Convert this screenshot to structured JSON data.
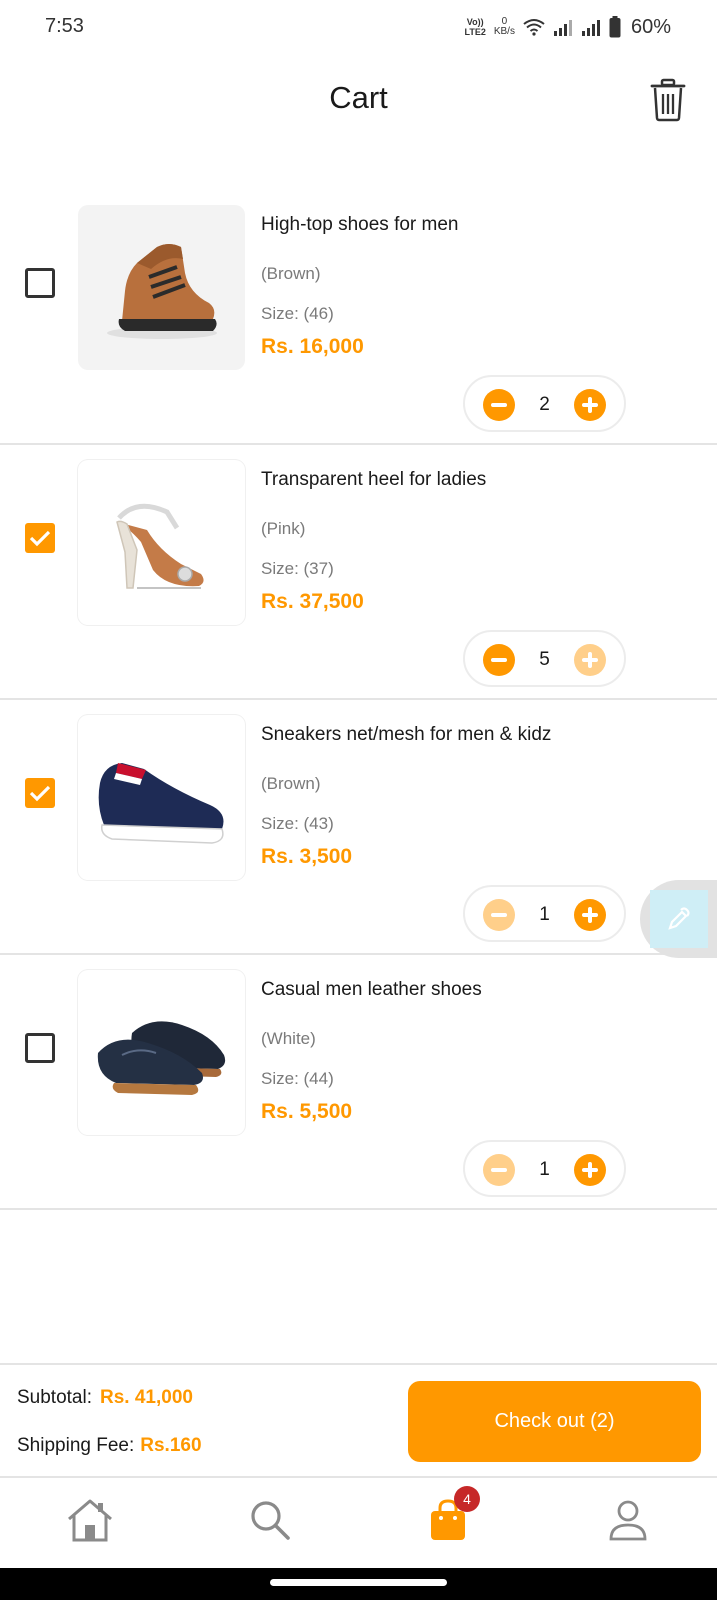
{
  "status_bar": {
    "time": "7:53",
    "network_top": "Vo))",
    "network_bottom": "LTE2",
    "speed_value": "0",
    "speed_unit": "KB/s",
    "battery": "60%"
  },
  "header": {
    "title": "Cart",
    "delete_icon": "trash-icon"
  },
  "colors": {
    "accent": "#ff9800",
    "accent_disabled": "#ffcf8a",
    "badge": "#c62828"
  },
  "cart_items": [
    {
      "name": "High-top shoes for men",
      "color": "(Brown)",
      "size": "Size: (46)",
      "price": "Rs. 16,000",
      "quantity": "2",
      "checked": false,
      "minus_enabled": true,
      "plus_enabled": true
    },
    {
      "name": "Transparent heel for ladies",
      "color": "(Pink)",
      "size": "Size: (37)",
      "price": "Rs. 37,500",
      "quantity": "5",
      "checked": true,
      "minus_enabled": true,
      "plus_enabled": false
    },
    {
      "name": "Sneakers net/mesh for men & kidz",
      "color": "(Brown)",
      "size": "Size: (43)",
      "price": "Rs. 3,500",
      "quantity": "1",
      "checked": true,
      "minus_enabled": false,
      "plus_enabled": true
    },
    {
      "name": "Casual men leather shoes",
      "color": "(White)",
      "size": "Size: (44)",
      "price": "Rs. 5,500",
      "quantity": "1",
      "checked": false,
      "minus_enabled": false,
      "plus_enabled": true
    }
  ],
  "summary": {
    "subtotal_label": "Subtotal:",
    "subtotal_value": "Rs. 41,000",
    "shipping_label": "Shipping Fee:",
    "shipping_value": "Rs.160",
    "checkout_label": "Check out (2)"
  },
  "nav": {
    "home_icon": "home-icon",
    "search_icon": "search-icon",
    "cart_icon": "shopping-bag-icon",
    "cart_badge": "4",
    "profile_icon": "user-icon"
  }
}
